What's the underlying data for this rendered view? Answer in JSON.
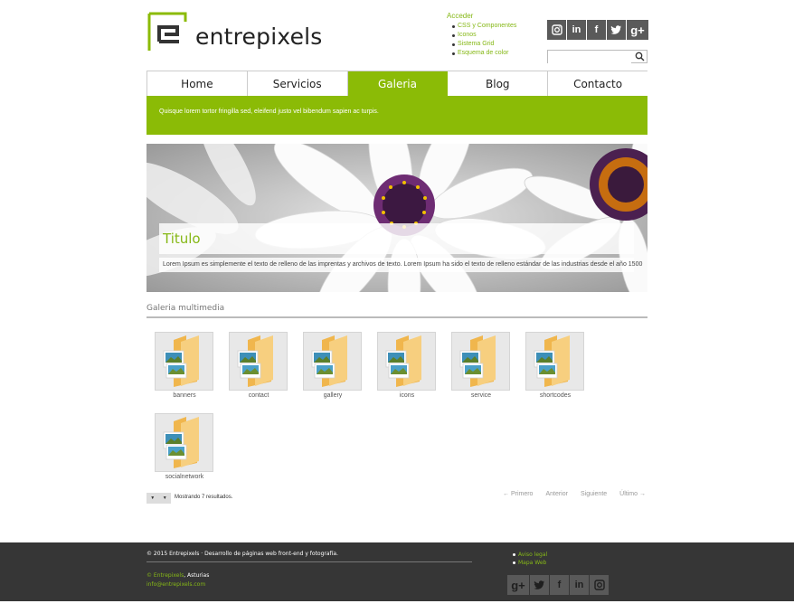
{
  "brand": {
    "name": "entrepixels",
    "accent": "#8bbb06"
  },
  "access": {
    "title": "Acceder",
    "items": [
      "CSS y Componentes",
      "Iconos",
      "Sistema Grid",
      "Esquema de color"
    ]
  },
  "social": [
    "instagram-icon",
    "linkedin-icon",
    "facebook-icon",
    "twitter-icon",
    "google-plus-icon"
  ],
  "search": {
    "placeholder": ""
  },
  "nav": {
    "items": [
      "Home",
      "Servicios",
      "Galeria",
      "Blog",
      "Contacto"
    ],
    "active": "Galeria"
  },
  "banner": {
    "text": "Quisque lorem tortor fringilla sed, eleifend justo vel bibendum sapien ac turpis."
  },
  "hero": {
    "title": "Titulo",
    "text": "Lorem Ipsum es simplemente el texto de relleno de las imprentas y archivos de texto. Lorem Ipsum ha sido el texto de relleno estándar de las industrias desde el año 1500"
  },
  "gallery": {
    "title": "Galeria multimedia",
    "folders": [
      "banners",
      "contact",
      "gallery",
      "icons",
      "service",
      "shortcodes",
      "socialnetwork"
    ]
  },
  "pager": {
    "info": "Mostrando 7 resultados.",
    "first": "← Primero",
    "prev": "Anterior",
    "next": "Siguiente",
    "last": "Último →"
  },
  "footer": {
    "copyright": "© 2015 Entrepixels · Desarrollo de páginas web front-end y fotografía.",
    "company": "© Entrepixels",
    "location": ", Asturias",
    "email": "info@entrepixels.com",
    "links": [
      "Aviso legal",
      "Mapa Web"
    ],
    "social": [
      "google-plus-icon",
      "twitter-icon",
      "facebook-icon",
      "linkedin-icon",
      "instagram-icon"
    ]
  }
}
